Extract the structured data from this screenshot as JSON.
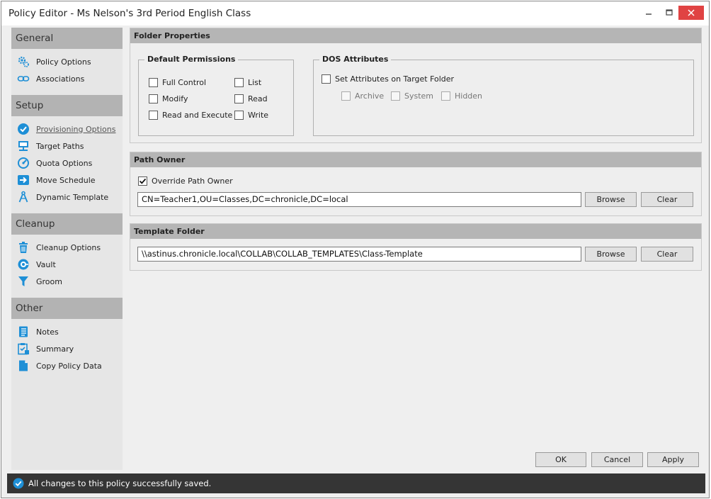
{
  "window": {
    "title": "Policy Editor - Ms Nelson's 3rd Period English Class",
    "controls": {
      "minimize": "–",
      "maximize": "□",
      "close": "✕"
    }
  },
  "sidebar": {
    "sections": [
      {
        "title": "General",
        "items": [
          {
            "label": "Policy Options",
            "icon": "gears-icon"
          },
          {
            "label": "Associations",
            "icon": "link-icon"
          }
        ]
      },
      {
        "title": "Setup",
        "items": [
          {
            "label": "Provisioning Options",
            "icon": "check-circle-icon",
            "active": true
          },
          {
            "label": "Target Paths",
            "icon": "network-icon"
          },
          {
            "label": "Quota Options",
            "icon": "gauge-icon"
          },
          {
            "label": "Move Schedule",
            "icon": "arrow-right-icon"
          },
          {
            "label": "Dynamic Template",
            "icon": "compass-icon"
          }
        ]
      },
      {
        "title": "Cleanup",
        "items": [
          {
            "label": "Cleanup Options",
            "icon": "trash-icon"
          },
          {
            "label": "Vault",
            "icon": "vault-icon"
          },
          {
            "label": "Groom",
            "icon": "funnel-icon"
          }
        ]
      },
      {
        "title": "Other",
        "items": [
          {
            "label": "Notes",
            "icon": "notes-icon"
          },
          {
            "label": "Summary",
            "icon": "summary-icon"
          },
          {
            "label": "Copy Policy Data",
            "icon": "copy-icon"
          }
        ]
      }
    ]
  },
  "folder_properties": {
    "title": "Folder Properties",
    "default_permissions": {
      "title": "Default Permissions",
      "options": [
        {
          "label": "Full Control",
          "checked": false
        },
        {
          "label": "List",
          "checked": false
        },
        {
          "label": "Modify",
          "checked": false
        },
        {
          "label": "Read",
          "checked": false
        },
        {
          "label": "Read and Execute",
          "checked": false
        },
        {
          "label": "Write",
          "checked": false
        }
      ]
    },
    "dos_attributes": {
      "title": "DOS Attributes",
      "set_attributes_label": "Set Attributes on Target Folder",
      "set_attributes_checked": false,
      "options": [
        {
          "label": "Archive",
          "checked": false
        },
        {
          "label": "System",
          "checked": false
        },
        {
          "label": "Hidden",
          "checked": false
        }
      ]
    }
  },
  "path_owner": {
    "title": "Path Owner",
    "override_label": "Override Path Owner",
    "override_checked": true,
    "value": "CN=Teacher1,OU=Classes,DC=chronicle,DC=local",
    "browse_label": "Browse",
    "clear_label": "Clear"
  },
  "template_folder": {
    "title": "Template Folder",
    "value": "\\\\astinus.chronicle.local\\COLLAB\\COLLAB_TEMPLATES\\Class-Template",
    "browse_label": "Browse",
    "clear_label": "Clear"
  },
  "footer": {
    "ok_label": "OK",
    "cancel_label": "Cancel",
    "apply_label": "Apply"
  },
  "status": {
    "message": "All changes to this policy successfully saved.",
    "icon": "check-circle-icon"
  },
  "colors": {
    "accent": "#1e8fd6",
    "close": "#e04343",
    "status_bg": "#353535"
  }
}
